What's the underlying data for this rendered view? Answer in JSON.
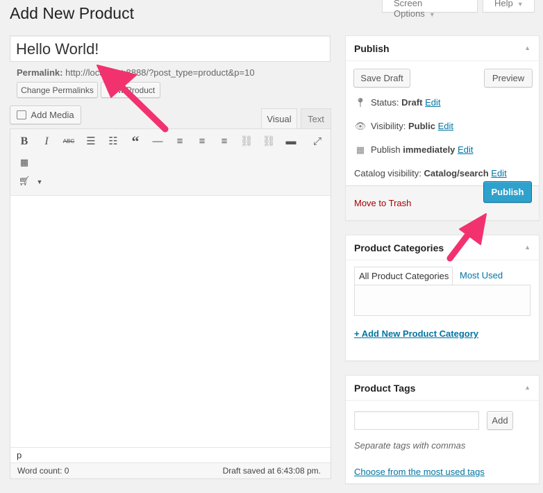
{
  "screen_tabs": {
    "screen_options": "Screen Options",
    "help": "Help"
  },
  "page_title": "Add New Product",
  "title_field": {
    "value": "Hello World!"
  },
  "permalink": {
    "label": "Permalink:",
    "url": "http://localhost:8888/?post_type=product&p=10",
    "change_button": "Change Permalinks",
    "view_button": "View Product"
  },
  "editor": {
    "add_media": "Add Media",
    "tab_visual": "Visual",
    "tab_text": "Text",
    "toolbar_icons": [
      "bold-icon",
      "italic-icon",
      "strikethrough-icon",
      "bullet-list-icon",
      "numbered-list-icon",
      "blockquote-icon",
      "horizontal-rule-icon",
      "align-left-icon",
      "align-center-icon",
      "align-right-icon",
      "link-icon",
      "unlink-icon",
      "read-more-icon",
      "fullscreen-icon",
      "toolbar-toggle-icon",
      "shortcode-cart-icon"
    ],
    "path": "p",
    "word_count": "Word count: 0",
    "draft_saved": "Draft saved at 6:43:08 pm."
  },
  "publish_box": {
    "title": "Publish",
    "save_draft": "Save Draft",
    "preview": "Preview",
    "status_label": "Status:",
    "status_value": "Draft",
    "visibility_label": "Visibility:",
    "visibility_value": "Public",
    "publish_label": "Publish",
    "publish_value": "immediately",
    "catalog_label": "Catalog visibility:",
    "catalog_value": "Catalog/search",
    "edit": "Edit",
    "move_to_trash": "Move to Trash",
    "publish_button": "Publish"
  },
  "categories_box": {
    "title": "Product Categories",
    "tab_all": "All Product Categories",
    "tab_most_used": "Most Used",
    "add_new": "+ Add New Product Category"
  },
  "tags_box": {
    "title": "Product Tags",
    "input_value": "",
    "add_button": "Add",
    "hint": "Separate tags with commas",
    "choose_link": "Choose from the most used tags"
  },
  "colors": {
    "accent_link": "#0074a2",
    "publish_button": "#2ea2cc",
    "trash_red": "#a00",
    "annotation_arrow": "#f2326f"
  }
}
